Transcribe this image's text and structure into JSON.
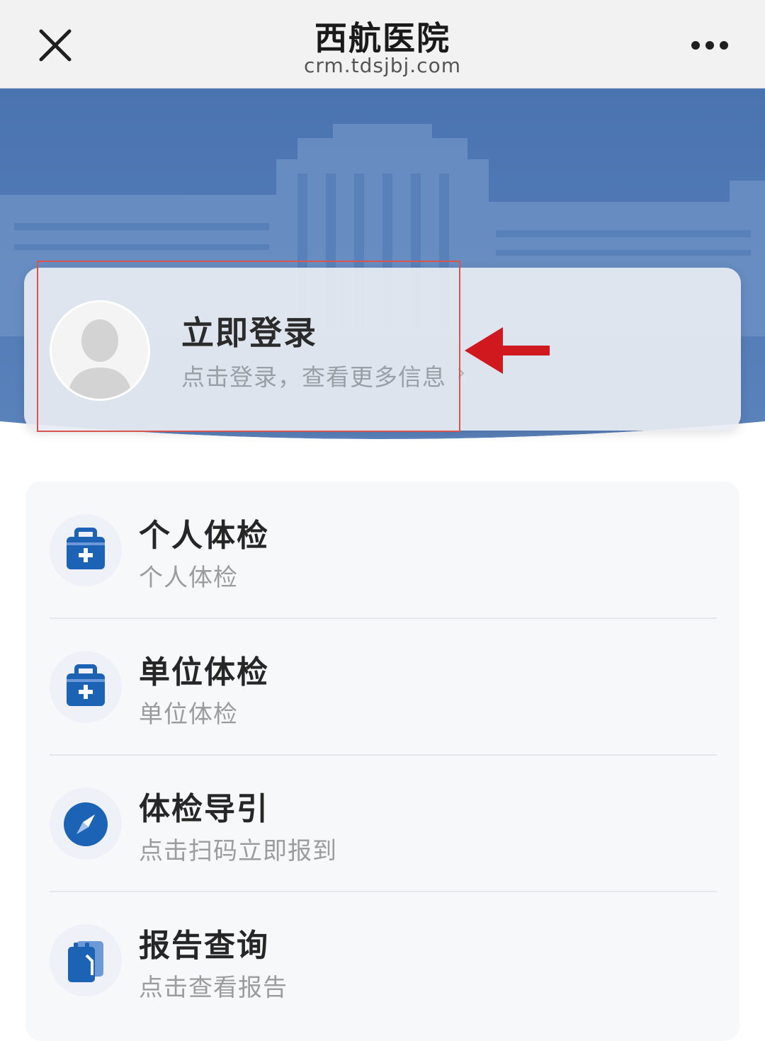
{
  "navbar": {
    "title": "西航医院",
    "url": "crm.tdsjbj.com",
    "close_icon": "close-icon",
    "more_icon": "more-icon"
  },
  "login": {
    "title": "立即登录",
    "subtitle": "点击登录，查看更多信息",
    "chevron": "›",
    "avatar_icon": "user-silhouette-icon"
  },
  "menu": {
    "items": [
      {
        "title": "个人体检",
        "subtitle": "个人体检",
        "icon": "medical-bag-icon"
      },
      {
        "title": "单位体检",
        "subtitle": "单位体检",
        "icon": "medical-bag-icon"
      },
      {
        "title": "体检导引",
        "subtitle": "点击扫码立即报到",
        "icon": "compass-icon"
      },
      {
        "title": "报告查询",
        "subtitle": "点击查看报告",
        "icon": "clipboard-icon"
      }
    ]
  },
  "colors": {
    "brand_blue": "#1d63b5",
    "banner_blue": "#3f6ba8",
    "annotation_red": "#d0191f"
  }
}
